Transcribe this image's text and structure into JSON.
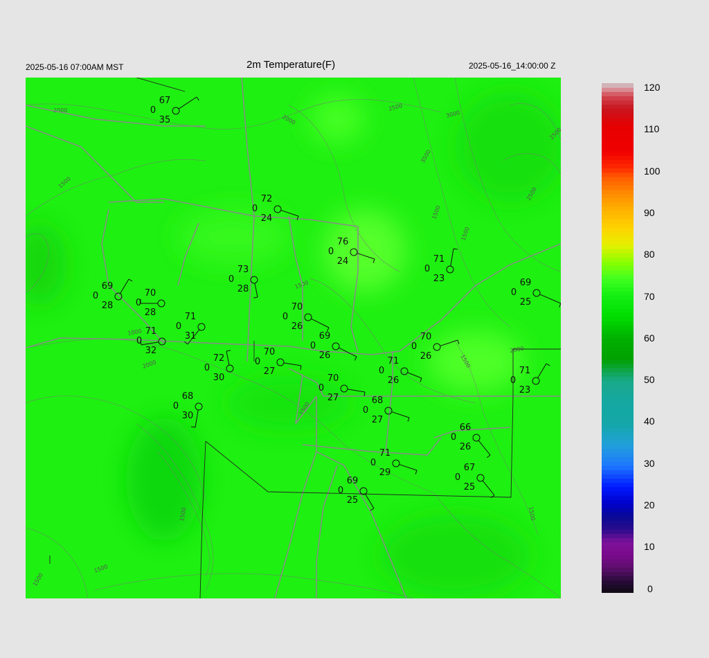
{
  "header": {
    "left": "2025-05-16 07:00AM MST",
    "title": "2m Temperature(F)",
    "right": "2025-05-16_14:00:00 Z"
  },
  "colorbar": {
    "ticks": [
      "120",
      "110",
      "100",
      "90",
      "80",
      "70",
      "60",
      "50",
      "40",
      "30",
      "20",
      "10",
      "0"
    ]
  },
  "stations": [
    {
      "t": "67",
      "d": "35"
    },
    {
      "t": "72",
      "d": "24"
    },
    {
      "t": "76",
      "d": "24"
    },
    {
      "t": "71",
      "d": "23"
    },
    {
      "t": "69",
      "d": "28"
    },
    {
      "t": "70",
      "d": "28"
    },
    {
      "t": "73",
      "d": "28"
    },
    {
      "t": "69",
      "d": "25"
    },
    {
      "t": "70",
      "d": "26"
    },
    {
      "t": "71",
      "d": "31"
    },
    {
      "t": "71",
      "d": "32"
    },
    {
      "t": "69",
      "d": "26"
    },
    {
      "t": "70",
      "d": "26"
    },
    {
      "t": "72",
      "d": "30"
    },
    {
      "t": "70",
      "d": "27"
    },
    {
      "t": "71",
      "d": "26"
    },
    {
      "t": "71",
      "d": "23"
    },
    {
      "t": "70",
      "d": "27"
    },
    {
      "t": "68",
      "d": "30"
    },
    {
      "t": "68",
      "d": "27"
    },
    {
      "t": "66",
      "d": "26"
    },
    {
      "t": "71",
      "d": "29"
    },
    {
      "t": "67",
      "d": "25"
    },
    {
      "t": "69",
      "d": "25"
    }
  ],
  "station_wind_speed": "0",
  "contour_labels": [
    "2000",
    "2000",
    "2500",
    "3000",
    "3500",
    "2500",
    "1500",
    "1500",
    "2000",
    "1000",
    "1500",
    "2000",
    "1500",
    "1500",
    "2500",
    "1500",
    "1500",
    "1500",
    "1500",
    "1500"
  ]
}
